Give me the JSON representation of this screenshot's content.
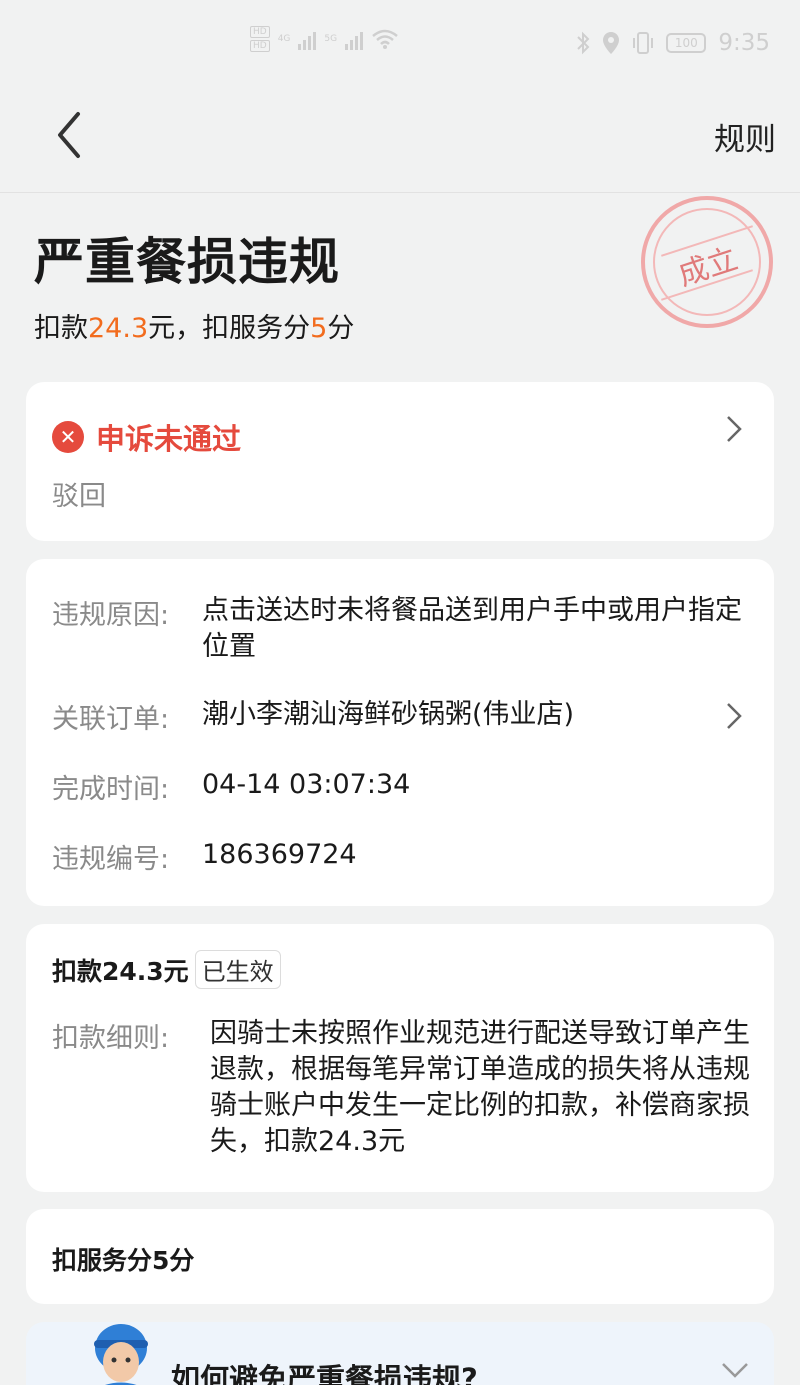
{
  "status_bar": {
    "network_badges": [
      "HD",
      "HD"
    ],
    "network_types": [
      "4G",
      "5G"
    ],
    "battery": "100",
    "time": "9:35"
  },
  "nav": {
    "rules_label": "规则"
  },
  "header": {
    "title": "严重餐损违规",
    "sub_prefix": "扣款",
    "sub_amount": "24.3",
    "sub_mid": "元，扣服务分",
    "sub_score": "5",
    "sub_suffix": "分",
    "stamp_text": "成立"
  },
  "appeal_card": {
    "status": "申诉未通过",
    "detail": "驳回"
  },
  "info_card": {
    "rows": [
      {
        "label": "违规原因:",
        "value": "点击送达时未将餐品送到用户手中或用户指定位置"
      },
      {
        "label": "关联订单:",
        "value": "潮小李潮汕海鲜砂锅粥(伟业店)"
      },
      {
        "label": "完成时间:",
        "value": "04-14 03:07:34"
      },
      {
        "label": "违规编号:",
        "value": "186369724"
      }
    ]
  },
  "deduct_card": {
    "title": "扣款24.3元",
    "badge": "已生效",
    "label": "扣款细则:",
    "detail": "因骑士未按照作业规范进行配送导致订单产生退款，根据每笔异常订单造成的损失将从违规骑士账户中发生一定比例的扣款，补偿商家损失，扣款24.3元"
  },
  "score_card": {
    "title": "扣服务分5分"
  },
  "tip_card": {
    "title": "如何避免严重餐损违规?"
  },
  "icons": [
    "back-arrow-icon",
    "chevron-right-icon",
    "close-circle-icon",
    "chevron-down-icon",
    "rider-avatar"
  ],
  "colors": {
    "accent_orange": "#f26c1e",
    "error_red": "#e54a3d",
    "stamp_red": "#e07a7a"
  }
}
